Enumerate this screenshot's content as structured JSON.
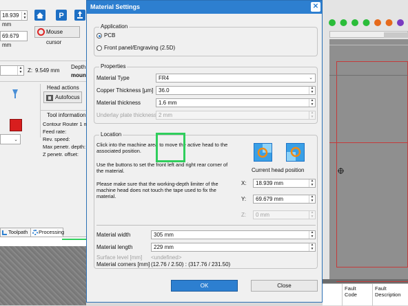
{
  "background_app": {
    "coords": {
      "x_value": "18.939 mm",
      "y_value": "69.679 mm"
    },
    "mouse_cursor_label": "Mouse cursor",
    "z_label": "Z:",
    "z_value": "9.549 mm",
    "depth_label": "Depth",
    "mount_label": "mount",
    "head_actions_label": "Head actions",
    "autofocus_label": "Autofocus",
    "tool_info": {
      "title": "Tool information",
      "lines": [
        "Contour Router 1 m",
        "Feed rate:",
        "Rev. speed:",
        "Max penetr. depth:",
        "Z penetr. offset:"
      ]
    },
    "tabs": [
      "Toolpath",
      "Processing"
    ],
    "fault_headers": [
      "Fault Code",
      "Fault Description"
    ]
  },
  "dialog": {
    "title": "Material Settings",
    "application": {
      "label": "Application",
      "options": [
        "PCB",
        "Front panel/Engraving (2.5D)"
      ],
      "selected_index": 0
    },
    "properties": {
      "label": "Properties",
      "material_type_label": "Material Type",
      "material_type_value": "FR4",
      "copper_thickness_label": "Copper Thickness [µm]",
      "copper_thickness_value": "36.0",
      "material_thickness_label": "Material thickness",
      "material_thickness_value": "1.6 mm",
      "underlay_label": "Underlay plate thickness",
      "underlay_value": "2 mm"
    },
    "location": {
      "label": "Location",
      "instruction_1": "Click into the machine area to move the active head to the associated position.",
      "instruction_2": "Use the buttons to set the front left and right rear corner of the material.",
      "instruction_3": "Please make sure that the working-depth limiter of the machine head does not touch the tape used to fix the material.",
      "current_head_position_label": "Current head position",
      "x_label": "X:",
      "x_value": "18.939 mm",
      "y_label": "Y:",
      "y_value": "69.679 mm",
      "z_label": "Z:",
      "z_value": "0 mm",
      "material_width_label": "Material width",
      "material_width_value": "305 mm",
      "material_length_label": "Material length",
      "material_length_value": "229 mm",
      "surface_level_label": "Surface level [mm]",
      "surface_level_value": "<undefined>",
      "material_corners_label": "Material corners [mm]",
      "material_corners_value": "(12.76 / 2.50) : (317.76 / 231.50)"
    },
    "buttons": {
      "ok": "OK",
      "close": "Close"
    }
  },
  "colors": {
    "accent": "#2d7fd0",
    "highlight": "#2fce5c",
    "status_dots": [
      "#2bbd3a",
      "#2bbd3a",
      "#2bbd3a",
      "#2bbd3a",
      "#e66a1c",
      "#e66a1c",
      "#7a3bc0"
    ]
  }
}
